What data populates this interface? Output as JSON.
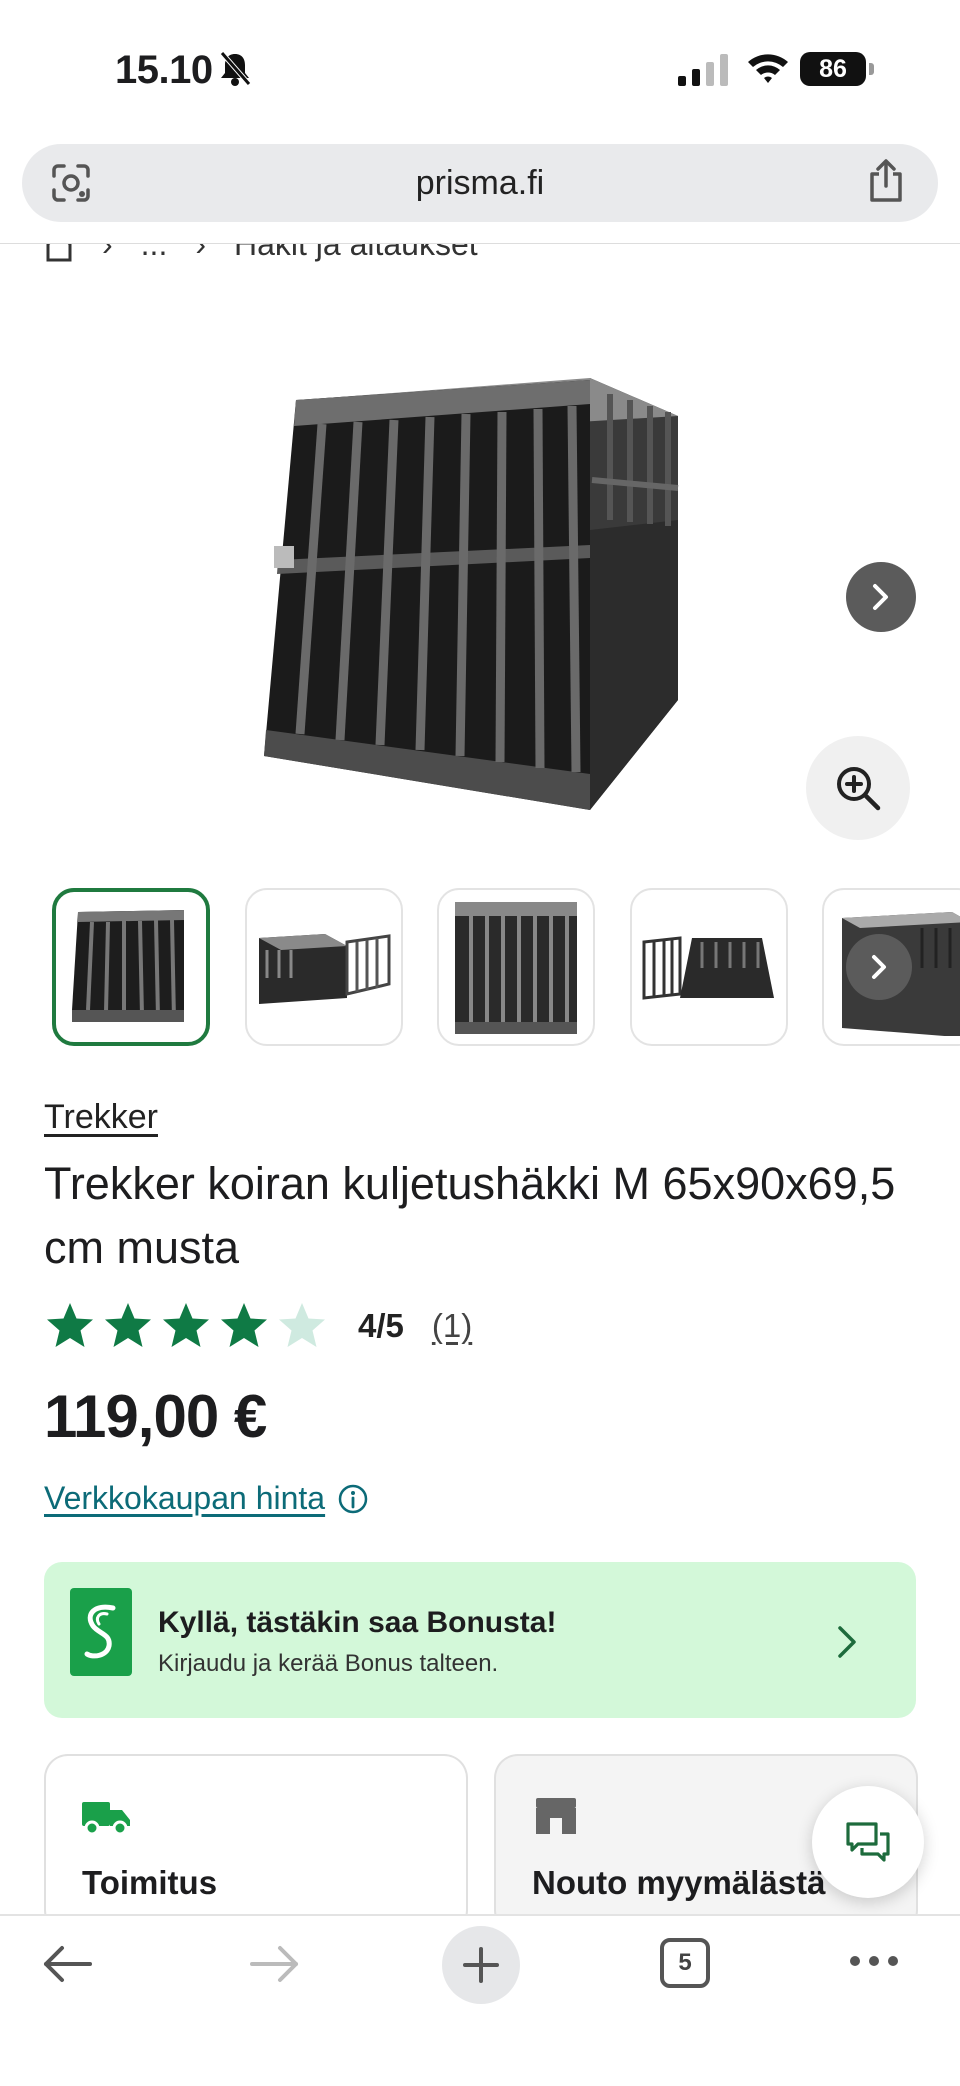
{
  "status_bar": {
    "time": "15.10",
    "battery": "86"
  },
  "browser": {
    "url": "prisma.fi",
    "open_tabs": "5"
  },
  "breadcrumb": {
    "ellipsis": "...",
    "current": "Häkit ja aitaukset"
  },
  "gallery": {
    "thumbnail_count": 5,
    "active_index": 0
  },
  "product": {
    "brand": "Trekker",
    "title": "Trekker koiran kuljetushäkki M 65x90x69,5 cm musta",
    "rating_value": 4,
    "rating_max": 5,
    "rating_text": "4/5",
    "review_count": "(1)",
    "price": "119,00 €",
    "price_note": "Verkkokaupan hinta"
  },
  "bonus_banner": {
    "heading": "Kyllä, tästäkin saa Bonusta!",
    "subtext": "Kirjaudu ja kerää Bonus talteen."
  },
  "delivery_options": [
    {
      "label": "Toimitus",
      "icon": "truck-icon"
    },
    {
      "label": "Nouto myymälästä",
      "icon": "store-icon"
    }
  ],
  "colors": {
    "brand_green": "#1aa04a",
    "star_green": "#0f7a45",
    "star_empty": "#cfeae0",
    "link_teal": "#0c6b78",
    "bonus_bg": "#d3f8d9"
  }
}
